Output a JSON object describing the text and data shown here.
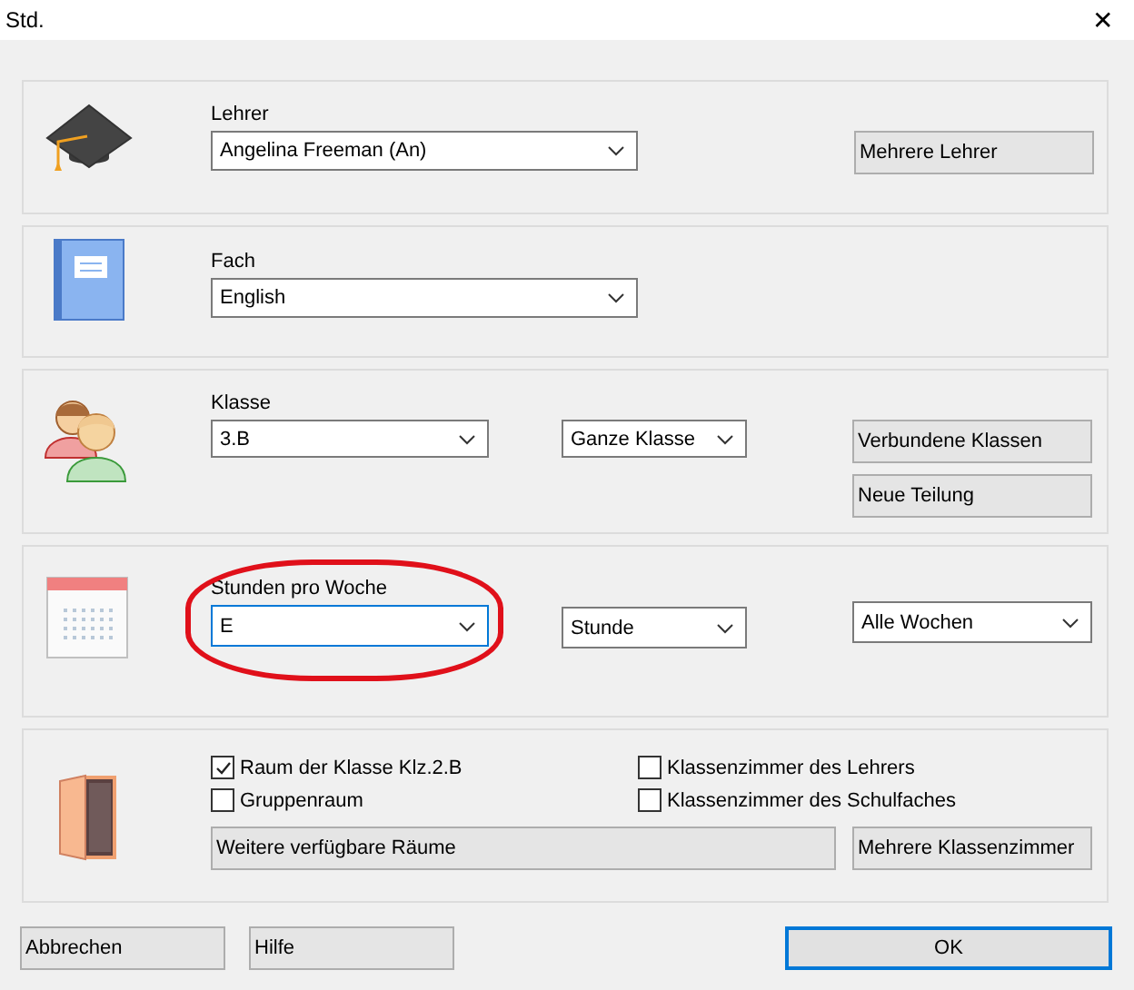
{
  "window": {
    "title": "Std.",
    "close": "✕"
  },
  "teacher": {
    "label": "Lehrer",
    "value": "Angelina Freeman (An)",
    "button": "Mehrere Lehrer"
  },
  "subject": {
    "label": "Fach",
    "value": "English"
  },
  "class": {
    "label": "Klasse",
    "value": "3.B",
    "split": "Ganze Klasse",
    "buttons": [
      "Verbundene Klassen",
      "Neue Teilung"
    ]
  },
  "hours": {
    "label": "Stunden pro Woche",
    "value": "E",
    "focused": true,
    "highlighted": true,
    "unit": "Stunde",
    "weeks": "Alle Wochen"
  },
  "room": {
    "options": [
      {
        "label": "Raum der Klasse Klz.2.B",
        "checked": true
      },
      {
        "label": "Klassenzimmer des Lehrers",
        "checked": false
      },
      {
        "label": "Gruppenraum",
        "checked": false
      },
      {
        "label": "Klassenzimmer des Schulfaches",
        "checked": false
      }
    ],
    "buttons": [
      "Weitere verfügbare Räume",
      "Mehrere Klassenzimmer"
    ]
  },
  "footer": {
    "buttons": [
      "Abbrechen",
      "Hilfe"
    ],
    "ok": "OK"
  }
}
